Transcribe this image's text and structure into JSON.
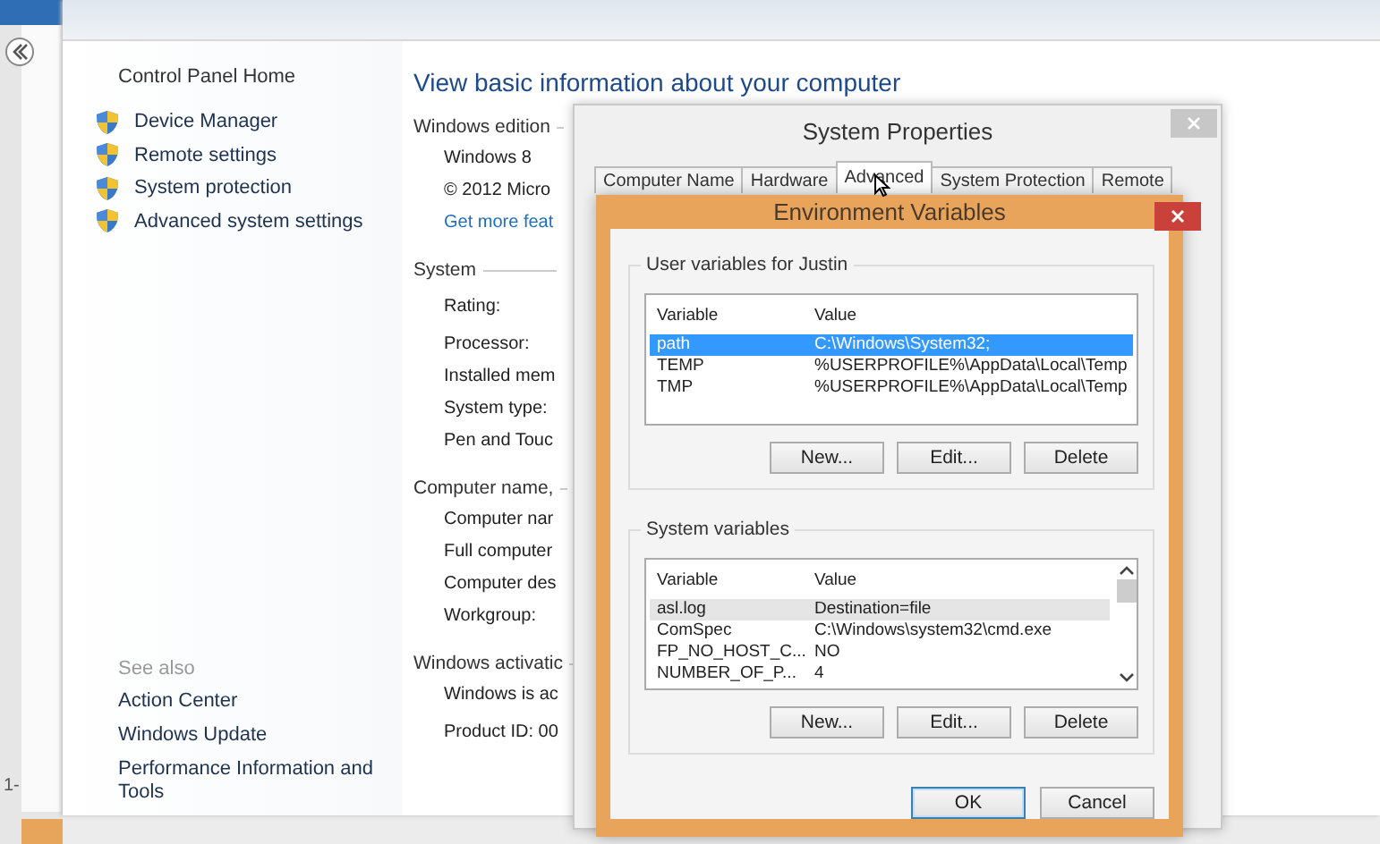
{
  "left_strip": {
    "fragment": "1-"
  },
  "sidebar": {
    "home_link": "Control Panel Home",
    "items": [
      {
        "label": "Device Manager"
      },
      {
        "label": "Remote settings"
      },
      {
        "label": "System protection"
      },
      {
        "label": "Advanced system settings"
      }
    ],
    "see_also_heading": "See also",
    "see_also": [
      "Action Center",
      "Windows Update",
      "Performance Information and Tools"
    ]
  },
  "content": {
    "title": "View basic information about your computer",
    "sections": [
      {
        "heading": "Windows edition",
        "rows": [
          {
            "text": "Windows 8",
            "kind": "text"
          },
          {
            "text": "© 2012 Micro",
            "kind": "text"
          },
          {
            "text": "Get more feat",
            "kind": "link"
          }
        ]
      },
      {
        "heading": "System",
        "rows": [
          {
            "text": "Rating:",
            "kind": "tall"
          },
          {
            "text": "Processor:",
            "kind": "text"
          },
          {
            "text": "Installed mem",
            "kind": "text"
          },
          {
            "text": "System type:",
            "kind": "text"
          },
          {
            "text": "Pen and Touc",
            "kind": "text"
          }
        ]
      },
      {
        "heading": "Computer name,",
        "rows": [
          {
            "text": "Computer nar",
            "kind": "text"
          },
          {
            "text": "Full computer",
            "kind": "text"
          },
          {
            "text": "Computer des",
            "kind": "text"
          },
          {
            "text": "Workgroup:",
            "kind": "text"
          }
        ]
      },
      {
        "heading": "Windows activatic",
        "rows": [
          {
            "text": "Windows is ac",
            "kind": "text"
          },
          {
            "text": "Product ID: 00",
            "kind": "tall"
          }
        ]
      }
    ]
  },
  "system_properties": {
    "title": "System Properties",
    "tabs": [
      {
        "label": "Computer Name",
        "selected": false
      },
      {
        "label": "Hardware",
        "selected": false
      },
      {
        "label": "Advanced",
        "selected": true
      },
      {
        "label": "System Protection",
        "selected": false
      },
      {
        "label": "Remote",
        "selected": false
      }
    ]
  },
  "environment_variables": {
    "title": "Environment Variables",
    "groups": [
      {
        "heading": "User variables for Justin",
        "focused": true,
        "scrollbar": false,
        "columns": [
          "Variable",
          "Value"
        ],
        "rows": [
          {
            "variable": "path",
            "value": "C:\\Windows\\System32;",
            "selected": true
          },
          {
            "variable": "TEMP",
            "value": "%USERPROFILE%\\AppData\\Local\\Temp",
            "selected": false
          },
          {
            "variable": "TMP",
            "value": "%USERPROFILE%\\AppData\\Local\\Temp",
            "selected": false
          }
        ],
        "buttons": [
          "New...",
          "Edit...",
          "Delete"
        ]
      },
      {
        "heading": "System variables",
        "focused": false,
        "scrollbar": true,
        "columns": [
          "Variable",
          "Value"
        ],
        "rows": [
          {
            "variable": "asl.log",
            "value": "Destination=file",
            "selected": true
          },
          {
            "variable": "ComSpec",
            "value": "C:\\Windows\\system32\\cmd.exe",
            "selected": false
          },
          {
            "variable": "FP_NO_HOST_C...",
            "value": "NO",
            "selected": false
          },
          {
            "variable": "NUMBER_OF_P...",
            "value": "4",
            "selected": false
          }
        ],
        "buttons": [
          "New...",
          "Edit...",
          "Delete"
        ]
      }
    ],
    "buttons": [
      {
        "label": "OK",
        "default": true
      },
      {
        "label": "Cancel",
        "default": false
      }
    ]
  }
}
